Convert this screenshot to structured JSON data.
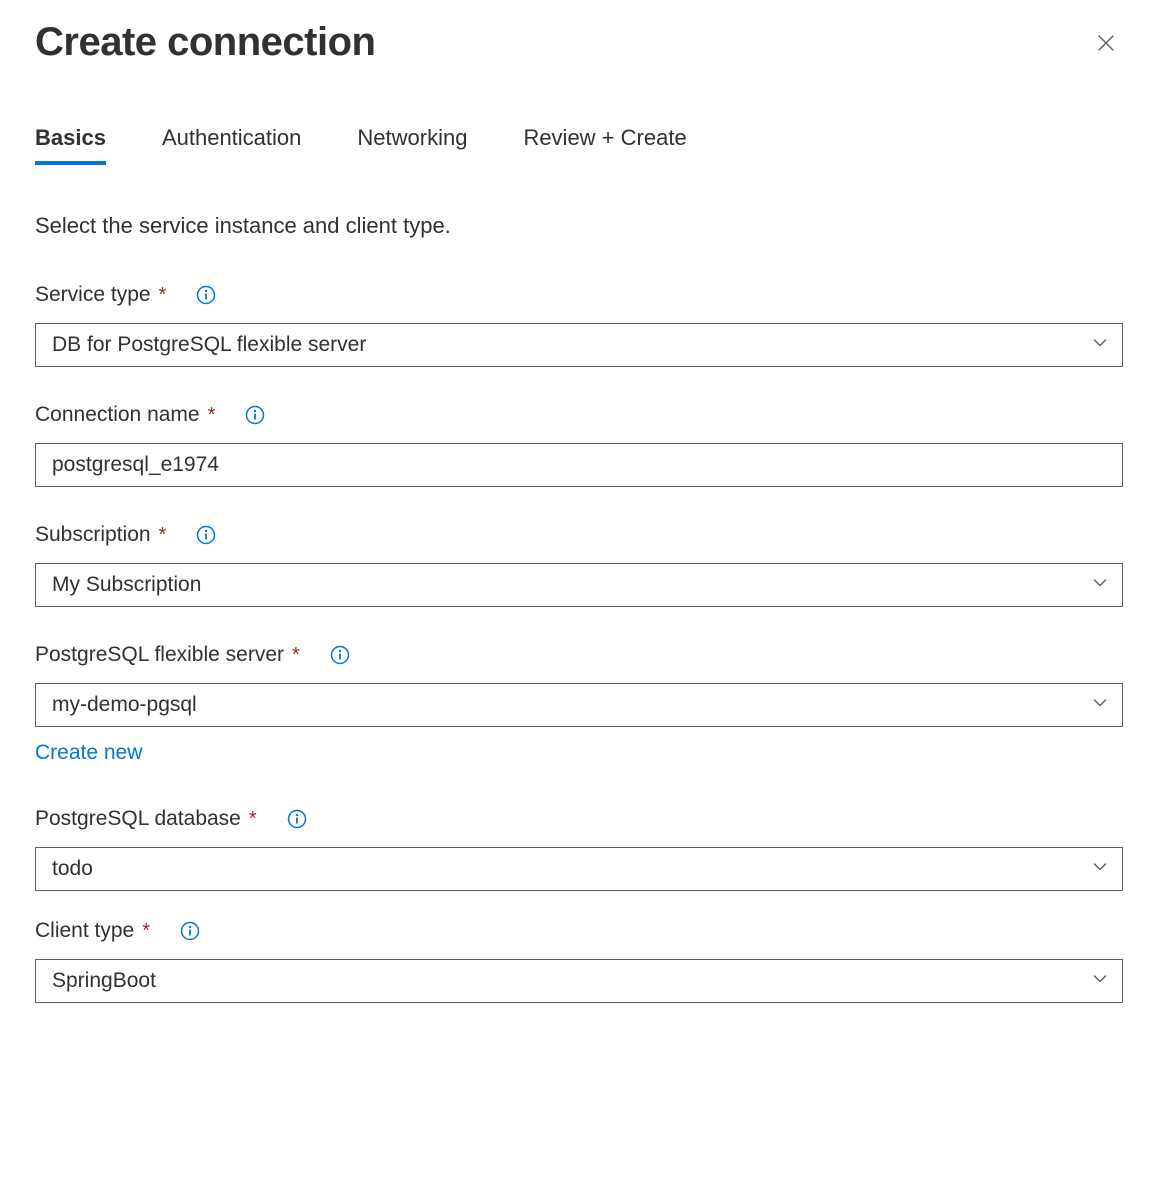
{
  "header": {
    "title": "Create connection"
  },
  "tabs": [
    {
      "label": "Basics",
      "active": true
    },
    {
      "label": "Authentication",
      "active": false
    },
    {
      "label": "Networking",
      "active": false
    },
    {
      "label": "Review + Create",
      "active": false
    }
  ],
  "instruction": "Select the service instance and client type.",
  "fields": {
    "serviceType": {
      "label": "Service type",
      "value": "DB for PostgreSQL flexible server"
    },
    "connectionName": {
      "label": "Connection name",
      "value": "postgresql_e1974"
    },
    "subscription": {
      "label": "Subscription",
      "value": "My Subscription"
    },
    "flexServer": {
      "label": "PostgreSQL flexible server",
      "value": "my-demo-pgsql",
      "createNewLabel": "Create new"
    },
    "database": {
      "label": "PostgreSQL database",
      "value": "todo"
    },
    "clientType": {
      "label": "Client type",
      "value": "SpringBoot"
    }
  }
}
